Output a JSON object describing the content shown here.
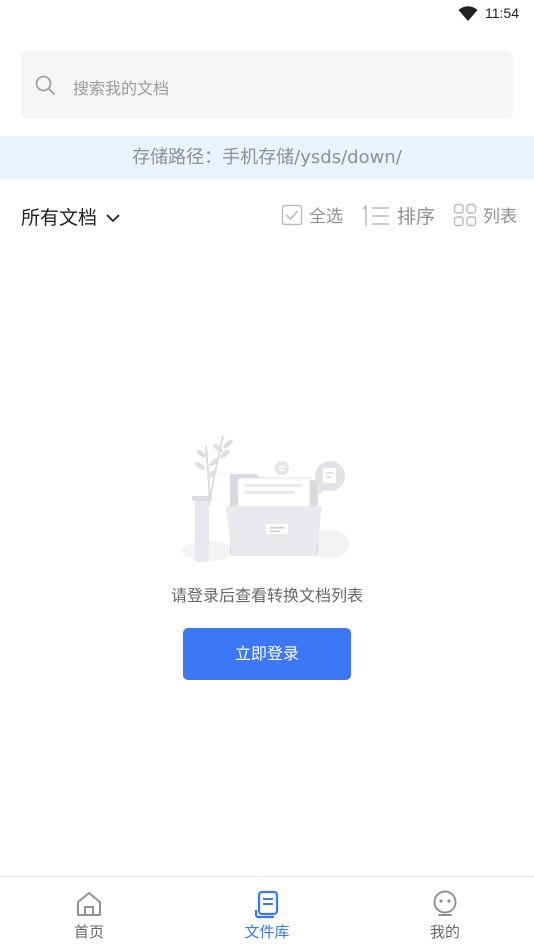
{
  "status_bar": {
    "time": "11:54"
  },
  "search": {
    "placeholder": "搜索我的文档"
  },
  "storage_path": "存储路径：手机存储/ysds/down/",
  "toolbar": {
    "filter_label": "所有文档",
    "select_all_label": "全选",
    "sort_label": "排序",
    "list_label": "列表"
  },
  "empty_state": {
    "message": "请登录后查看转换文档列表",
    "login_button": "立即登录"
  },
  "tabbar": {
    "items": [
      {
        "label": "首页",
        "icon": "home-icon"
      },
      {
        "label": "文件库",
        "icon": "file-library-icon",
        "active": true
      },
      {
        "label": "我的",
        "icon": "profile-icon"
      }
    ]
  },
  "colors": {
    "accent": "#3b77f6",
    "path_bar_bg": "#eaf2fd",
    "muted_text": "#8f9196",
    "search_bg": "#f5f5f6"
  }
}
